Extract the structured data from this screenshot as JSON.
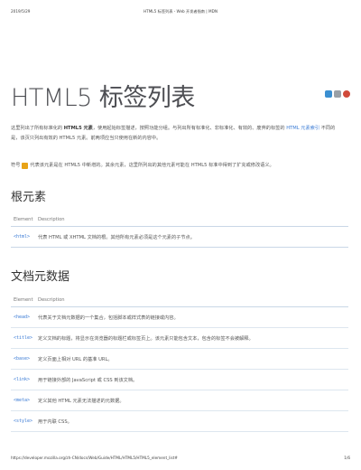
{
  "print_header": {
    "date": "2019/5/29",
    "title": "HTML5 标签列表 - Web 开发者指南 | MDN"
  },
  "page": {
    "title": "HTML5 标签列表"
  },
  "social": {
    "icons": [
      "share-icon",
      "print-icon",
      "weibo-icon"
    ]
  },
  "intro": {
    "part1": "这里列出了所有标准化的 ",
    "bold": "HTML5 元素",
    "part2": "，使用起始标签描述，按照功能分组。与列出所有标准化、非标准化、有效的、废弃的标签的 ",
    "link": "HTML 元素索引",
    "part3": " 不同的是，该页只列出有效的 HTML5 元素。前两项应当只使用在新的内容中。"
  },
  "note": {
    "prefix": "符号",
    "text": "代表该元素是在 HTML5 中新增的。其余元素，这里所列出的其他元素可能在 HTML5 标准中得到了扩充或修改语义。"
  },
  "section_root": {
    "heading": "根元素",
    "col_element": "Element",
    "col_description": "Description",
    "rows": [
      {
        "tag": "<html>",
        "desc": "代表 HTML 或 XHTML 文档的根。其他所有元素必须是这个元素的子节点。"
      }
    ]
  },
  "section_meta": {
    "heading": "文档元数据",
    "col_element": "Element",
    "col_description": "Description",
    "rows": [
      {
        "tag": "<head>",
        "desc": "代表关于文档元数据的一个集合，包括脚本或样式表的链接或内容。"
      },
      {
        "tag": "<title>",
        "desc": "定义文档的标题，将显示在浏览器的标题栏或标签页上。该元素只能包含文本，包含的标签不会被解释。"
      },
      {
        "tag": "<base>",
        "desc": "定义页面上相对 URL 的基准 URL。"
      },
      {
        "tag": "<link>",
        "desc": "用于链接外部的 JavaScript 或 CSS 到该文档。"
      },
      {
        "tag": "<meta>",
        "desc": "定义其他 HTML 元素无法描述的元数据。"
      },
      {
        "tag": "<style>",
        "desc": "用于内联 CSS。"
      }
    ]
  },
  "print_footer": {
    "url": "https://developer.mozilla.org/zh-CN/docs/Web/Guide/HTML/HTML5/HTML5_element_list#",
    "page": "1/6"
  }
}
